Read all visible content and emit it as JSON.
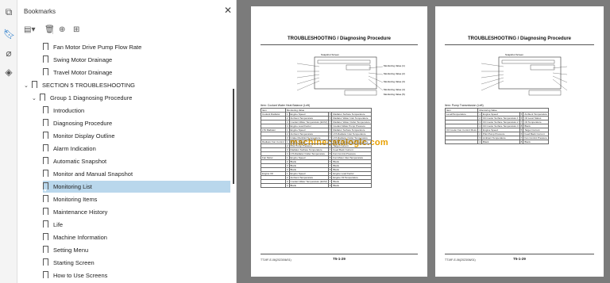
{
  "panel": {
    "title": "Bookmarks",
    "close_glyph": "✕"
  },
  "toolbar": {
    "options_icon": "options-icon",
    "delete_icon": "trash-icon",
    "add_icon": "add-bookmark-icon",
    "expand_icon": "bookmark-expand-icon"
  },
  "bookmarks": [
    {
      "label": "Fan Motor Drive Pump Flow Rate",
      "level": 2
    },
    {
      "label": "Swing Motor Drainage",
      "level": 2
    },
    {
      "label": "Travel Motor Drainage",
      "level": 2
    },
    {
      "label": "SECTION 5 TROUBLESHOOTING",
      "level": 0
    },
    {
      "label": "Group 1 Diagnosing Procedure",
      "level": 1
    },
    {
      "label": "Introduction",
      "level": 2
    },
    {
      "label": "Diagnosing Procedure",
      "level": 2
    },
    {
      "label": "Monitor Display Outline",
      "level": 2
    },
    {
      "label": "Alarm Indication",
      "level": 2
    },
    {
      "label": "Automatic Snapshot",
      "level": 2
    },
    {
      "label": "Monitor and Manual Snapshot",
      "level": 2
    },
    {
      "label": "Monitoring List",
      "level": 2
    },
    {
      "label": "Monitoring Items",
      "level": 2
    },
    {
      "label": "Maintenance History",
      "level": 2
    },
    {
      "label": "Life",
      "level": 2
    },
    {
      "label": "Machine Information",
      "level": 2
    },
    {
      "label": "Setting Menu",
      "level": 2
    },
    {
      "label": "Starting Screen",
      "level": 2
    },
    {
      "label": "How to Use Screens",
      "level": 2
    }
  ],
  "selected_label": "Monitoring List",
  "page_left": {
    "title": "TROUBLESHOOTING / Diagnosing Procedure",
    "diagram_title": "Snapshot Screen",
    "monitoring_labels": [
      "Monitoring Value (1)",
      "Monitoring Value (2)",
      "Monitoring Value (3)",
      "Monitoring Value (4)",
      "Monitoring Value (5)"
    ],
    "caption": "Item: Coolant Water Heat Balance (Left)",
    "table_head": [
      "Item",
      "Monitoring Value"
    ],
    "rows": [
      [
        "Coolant Radiator",
        "1",
        "Engine Speed",
        "5",
        "Radiator Surface Temperature"
      ],
      [
        "",
        "2",
        "Ambient Temperature",
        "6",
        "Radiator Water Inlet Temperature"
      ],
      [
        "",
        "3",
        "Coolant Water Temperature (ECM)",
        "7",
        "Radiator Water Outlet Temperature"
      ],
      [
        "",
        "4",
        "Engine Load Factor",
        "8",
        "Coolant Water Pump Pressure"
      ],
      [
        "LTA Radiator",
        "1",
        "Engine Speed",
        "5",
        "Radiator Surface Temperature"
      ],
      [
        "",
        "2",
        "Ambient Temperature",
        "6",
        "LTA Radiator Inlet Temperature"
      ],
      [
        "",
        "3",
        "Intake Manifold Temperature",
        "7",
        "LTA Radiator Outlet Temperature"
      ],
      [
        "Radiator Fan Control",
        "1",
        "Engine Speed",
        "5",
        "Radiator Water Inlet Temperature"
      ],
      [
        "",
        "2",
        "Pilot Pump Pressure",
        "6",
        "Target Current"
      ],
      [
        "",
        "3",
        "Radiator Surface Temperature",
        "7",
        "Feed Back Current"
      ],
      [
        "",
        "4",
        "LTA Radiator Outlet Temperature",
        "8",
        "Fan Control Pressure"
      ],
      [
        "Fan Motor",
        "1",
        "Engine Speed",
        "5",
        "Fan Motor Inlet Temperature"
      ],
      [
        "",
        "2",
        "Blank",
        "6",
        "Blank"
      ],
      [
        "",
        "3",
        "Blank",
        "7",
        "Blank"
      ],
      [
        "",
        "4",
        "Blank",
        "8",
        "Blank"
      ],
      [
        "Engine Oil",
        "1",
        "Engine Speed",
        "5",
        "Engine Load Factor"
      ],
      [
        "",
        "2",
        "Ambient Temperature",
        "6",
        "Engine Oil Temperature"
      ],
      [
        "",
        "3",
        "Coolant Water Temperature (ECM)",
        "7",
        "Blank"
      ],
      [
        "",
        "4",
        "Blank",
        "8",
        "Blank"
      ]
    ],
    "footer_left": "TT19F-E-06(2023/06/01)",
    "page_no": "T5-1-29"
  },
  "page_right": {
    "title": "TROUBLESHOOTING / Diagnosing Procedure",
    "caption": "Item: Pump Transmission (Left)",
    "table_head": [
      "Item",
      "Monitoring Value"
    ],
    "rows": [
      [
        "Level/Temperature",
        "1",
        "Engine Speed",
        "5",
        "Ambient Temperature"
      ],
      [
        "",
        "2",
        "Oil Cooler Surface Temperature 1",
        "6",
        "Oil Level Status"
      ],
      [
        "",
        "3",
        "Oil Cooler Surface Temperature 2",
        "7",
        "Oil Temperature"
      ],
      [
        "",
        "4",
        "Oil Cooler Surface Temperature 3",
        "8",
        "Blank"
      ],
      [
        "Oil Cooler Fan Control Motor",
        "1",
        "Engine Speed",
        "5",
        "Target Current"
      ],
      [
        "",
        "2",
        "Pilot Pump Pressure",
        "6",
        "Feed Back Current"
      ],
      [
        "",
        "3",
        "Ambient Temperature",
        "7",
        "Fan Control Pressure"
      ],
      [
        "",
        "4",
        "Blank",
        "8",
        "Blank"
      ]
    ],
    "footer_left": "TT19F-E-06(2023/06/01)",
    "page_no": "T5-1-29"
  },
  "watermark": "machinecatalogic.com"
}
